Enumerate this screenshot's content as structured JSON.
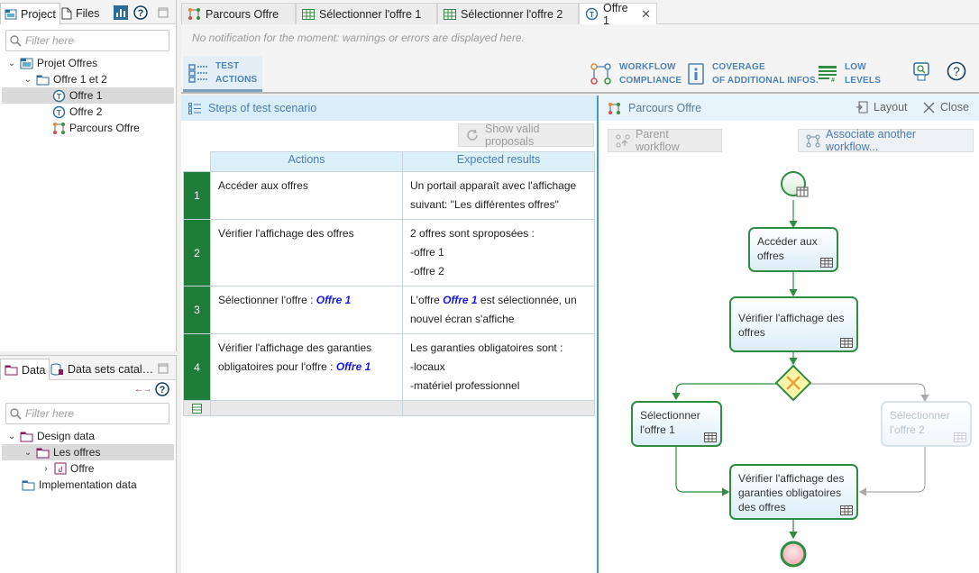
{
  "left_top": {
    "tabs": [
      {
        "label": "Project",
        "active": true
      },
      {
        "label": "Files",
        "active": false
      }
    ],
    "filter_placeholder": "Filter here",
    "tree": [
      {
        "label": "Projet Offres",
        "icon": "project-icon"
      },
      {
        "label": "Offre 1 et 2",
        "icon": "folder-icon"
      },
      {
        "label": "Offre 1",
        "icon": "test-scenario-icon",
        "selected": true
      },
      {
        "label": "Offre 2",
        "icon": "test-scenario-icon"
      },
      {
        "label": "Parcours Offre",
        "icon": "workflow-icon"
      }
    ]
  },
  "left_bottom": {
    "tabs": [
      {
        "label": "Data",
        "active": true
      },
      {
        "label": "Data sets catal…",
        "active": false
      }
    ],
    "filter_placeholder": "Filter here",
    "tree": [
      {
        "label": "Design data",
        "icon": "data-folder-icon"
      },
      {
        "label": "Les offres",
        "icon": "data-folder-icon",
        "selected": true
      },
      {
        "label": "Offre",
        "icon": "data-item-icon"
      },
      {
        "label": "Implementation data",
        "icon": "folder-icon"
      }
    ]
  },
  "editor_tabs": [
    {
      "label": "Parcours Offre",
      "icon": "workflow-icon",
      "active": false
    },
    {
      "label": "Sélectionner l'offre 1",
      "icon": "table-icon",
      "active": false
    },
    {
      "label": "Sélectionner l'offre 2",
      "icon": "table-icon",
      "active": false
    },
    {
      "label": "Offre 1",
      "icon": "test-scenario-icon",
      "active": true
    }
  ],
  "notification": "No notification for the moment: warnings or errors are displayed here.",
  "modes": [
    {
      "line1": "TEST",
      "line2": "ACTIONS",
      "icon": "test-actions-icon",
      "active": true
    },
    {
      "line1": "WORKFLOW",
      "line2": "COMPLIANCE",
      "icon": "workflow-compliance-icon"
    },
    {
      "line1": "COVERAGE",
      "line2": "OF ADDITIONAL INFOS.",
      "icon": "info-icon"
    },
    {
      "line1": "LOW",
      "line2": "LEVELS",
      "icon": "low-levels-icon"
    }
  ],
  "steps_panel": {
    "title": "Steps of test scenario",
    "show_valid_label": "Show valid proposals",
    "col_actions": "Actions",
    "col_expected": "Expected results",
    "rows": [
      {
        "num": "1",
        "action": [
          "Accéder aux offres"
        ],
        "expected": [
          "Un portail apparaît avec l'affichage",
          "suivant: \"Les différentes offres\""
        ]
      },
      {
        "num": "2",
        "action": [
          "Vérifier l'affichage des offres"
        ],
        "expected": [
          "2 offres sont sproposées :",
          "-offre 1",
          "-offre 2"
        ]
      },
      {
        "num": "3",
        "action_prefix": "Sélectionner l'offre : ",
        "action_ref": "Offre 1",
        "expected_prefix": "L'offre ",
        "expected_ref": "Offre 1",
        "expected_suffix": " est sélectionnée, un",
        "expected_line2": "nouvel écran s'affiche"
      },
      {
        "num": "4",
        "action_line1": "Vérifier l'affichage des garanties",
        "action_prefix": "obligatoires pour l'offre : ",
        "action_ref": "Offre 1",
        "expected": [
          "Les garanties obligatoires sont :",
          "-locaux",
          "-matériel professionnel"
        ]
      }
    ]
  },
  "workflow_panel": {
    "title": "Parcours Offre",
    "layout_label": "Layout",
    "close_label": "Close",
    "parent_label": "Parent workflow",
    "associate_label": "Associate another workflow...",
    "nodes": {
      "acceder": [
        "Accéder aux",
        "offres"
      ],
      "verifier_offres": [
        "Vérifier l'affichage des",
        "offres"
      ],
      "select1": [
        "Sélectionner",
        "l'offre 1"
      ],
      "select2": [
        "Sélectionner",
        "l'offre 2"
      ],
      "verifier_garanties": [
        "Vérifier l'affichage des",
        "garanties obligatoires",
        "des offres"
      ]
    }
  },
  "colors": {
    "step_number_bg": "#1f7d3a",
    "node_border": "#2f8c42",
    "accent_blue": "#4a7fb4",
    "ref_blue": "#1a1ae0"
  }
}
